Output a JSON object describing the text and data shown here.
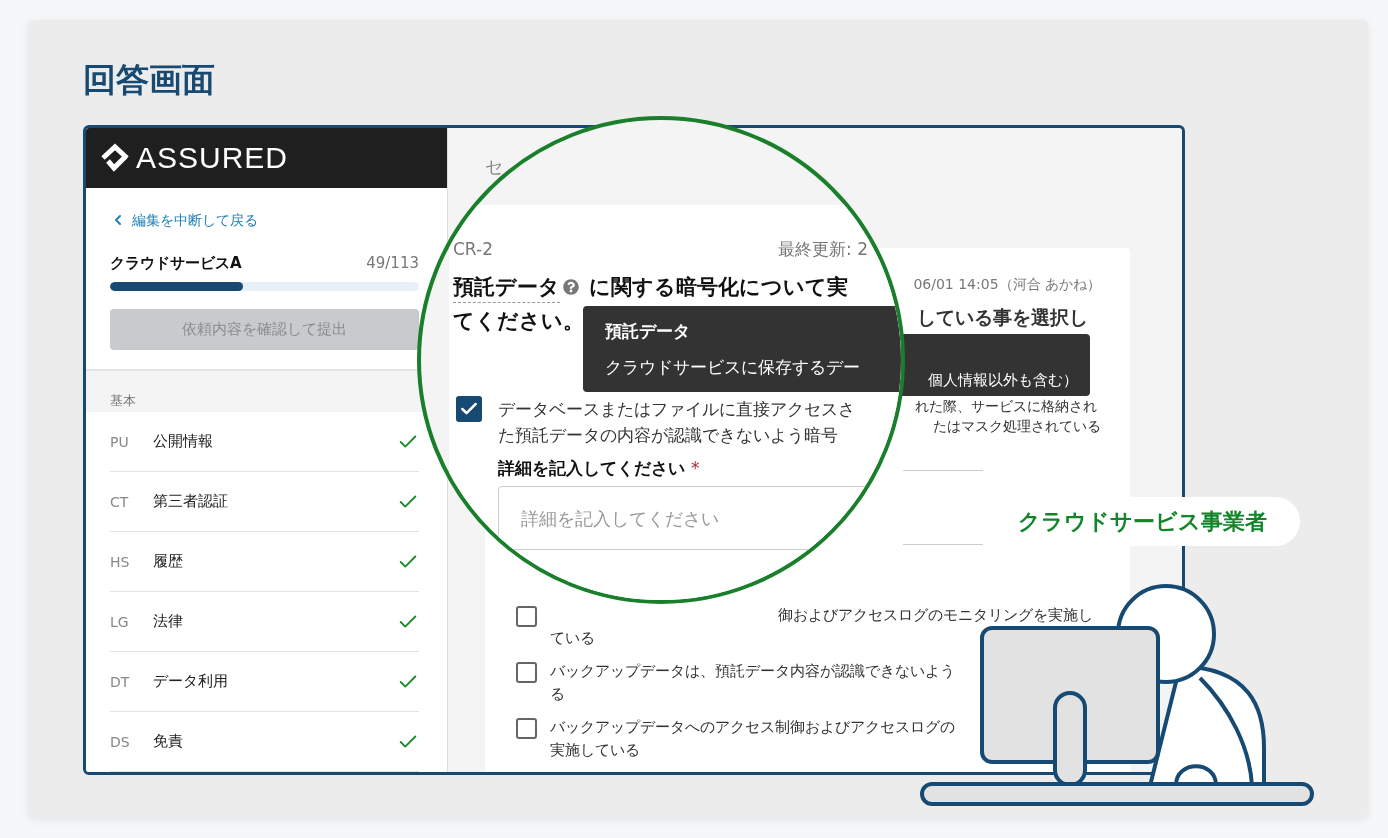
{
  "heading": "回答画面",
  "app": {
    "logo": "ASSURED",
    "sidebar": {
      "back_link": "編集を中断して戻る",
      "project": "クラウドサービスA",
      "count": "49/113",
      "progress": {
        "level": 0.43
      },
      "submit_button": {
        "label": "依頼内容を確認して提出",
        "disabled": true
      },
      "section": "基本",
      "items": [
        {
          "code": "PU",
          "label": "公開情報",
          "done": true
        },
        {
          "code": "CT",
          "label": "第三者認証",
          "done": true
        },
        {
          "code": "HS",
          "label": "履歴",
          "done": true
        },
        {
          "code": "LG",
          "label": "法律",
          "done": true
        },
        {
          "code": "DT",
          "label": "データ利用",
          "done": true
        },
        {
          "code": "DS",
          "label": "免責",
          "done": true
        }
      ]
    },
    "main": {
      "page_title_fragment": "セ",
      "card": {
        "updated_fragment": "06/01 14:05（河合 あかね）",
        "title_fragment": "している事を選択し",
        "tooltip_fragment": "個人情報以外も含む）",
        "text_fragments": [
          "れた際、サービスに格納され",
          "たはマスク処理されている"
        ],
        "options": [
          {
            "kind": "cut",
            "checked": false,
            "lines": [
              "御およびアクセスログのモニタリングを実施し",
              "ている"
            ]
          },
          {
            "kind": "full",
            "checked": false,
            "lines": [
              "バックアップデータは、預託データ内容が認識できないよう",
              "る"
            ]
          },
          {
            "kind": "full",
            "checked": false,
            "lines": [
              "バックアップデータへのアクセス制御およびアクセスログの",
              "実施している"
            ]
          }
        ]
      }
    }
  },
  "magnifier": {
    "id": "CR-2",
    "updated": "最終更新: 2",
    "title": {
      "term": "預託データ",
      "rest": "に関する暗号化について実",
      "line2": "てください。"
    },
    "tooltip": {
      "term": "預託データ",
      "text": "クラウドサービスに保存するデー"
    },
    "option": {
      "checked": true,
      "lines": [
        "データベースまたはファイルに直接アクセスさ",
        "た預託データの内容が認識できないよう暗号"
      ]
    },
    "detail": {
      "label": "詳細を記入してください",
      "required_mark": "*",
      "placeholder": "詳細を記入してください"
    }
  },
  "role_label": "クラウドサービス事業者"
}
